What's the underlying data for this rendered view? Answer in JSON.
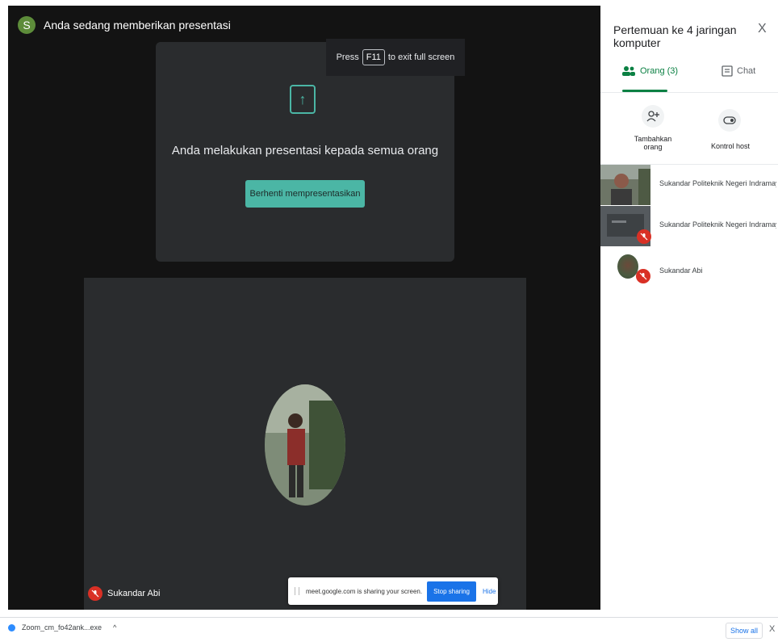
{
  "header": {
    "avatar_letter": "S",
    "title": "Anda sedang memberikan presentasi"
  },
  "fullscreen_tip": {
    "press": "Press",
    "key": "F11",
    "rest": "to exit full screen"
  },
  "presentation": {
    "message": "Anda melakukan presentasi kepada semua orang",
    "stop_button": "Berhenti mempresentasikan",
    "upload_icon": "↑"
  },
  "tile": {
    "name": "Sukandar Abi"
  },
  "share_bar": {
    "text": "meet.google.com is sharing your screen.",
    "stop": "Stop sharing",
    "hide": "Hide"
  },
  "panel": {
    "title": "Pertemuan ke 4 jaringan komputer",
    "close": "X",
    "tabs": [
      {
        "label": "Orang (3)"
      },
      {
        "label": "Chat"
      }
    ],
    "actions": [
      {
        "label": "Tambahkan orang"
      },
      {
        "label": "Kontrol host"
      }
    ],
    "people": [
      {
        "name": "Sukandar Politeknik Negeri Indramay..."
      },
      {
        "name": "Sukandar Politeknik Negeri Indramay..."
      },
      {
        "name": "Sukandar Abi"
      }
    ]
  },
  "download_bar": {
    "file": "Zoom_cm_fo42ank...exe",
    "chevron": "^",
    "show_all": "Show all",
    "close": "X"
  },
  "colors": {
    "accent_teal": "#4bb6a5",
    "meet_green": "#0b8043",
    "mute_red": "#d93025",
    "link_blue": "#1a73e8"
  }
}
